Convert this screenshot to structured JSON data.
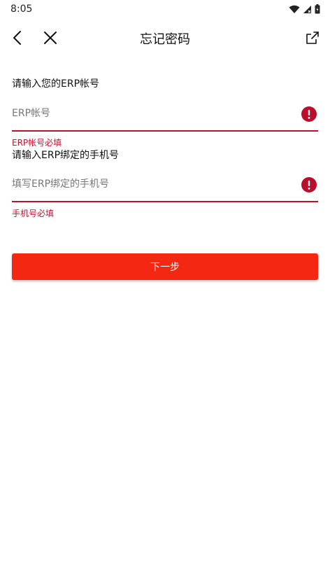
{
  "status_bar": {
    "time": "8:05",
    "icons": [
      "wifi-icon",
      "cellular-icon",
      "battery-icon"
    ]
  },
  "nav": {
    "title": "忘记密码",
    "back_icon": "chevron-left-icon",
    "close_icon": "close-icon",
    "share_icon": "share-icon"
  },
  "form": {
    "erp_section_label": "请输入您的ERP帐号",
    "erp_field": {
      "value": "",
      "placeholder": "ERP帐号",
      "error": "ERP帐号必填"
    },
    "phone_section_label": "请输入ERP绑定的手机号",
    "phone_field": {
      "value": "",
      "placeholder": "填写ERP绑定的手机号",
      "error": "手机号必填"
    },
    "next_button_label": "下一步"
  },
  "colors": {
    "accent": "#f32712",
    "error": "#c8102e",
    "underline": "#b8152a",
    "background": "#ffffff"
  }
}
